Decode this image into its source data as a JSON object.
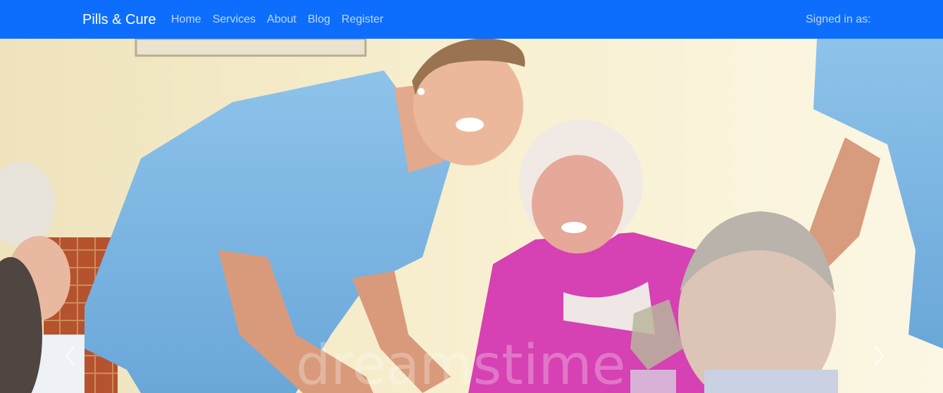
{
  "navbar": {
    "brand": "Pills & Cure",
    "links": [
      {
        "label": "Home"
      },
      {
        "label": "Services"
      },
      {
        "label": "About"
      },
      {
        "label": "Blog"
      },
      {
        "label": "Register"
      }
    ],
    "signed_in_label": "Signed in as:"
  },
  "carousel": {
    "image_watermark": "dreamstime",
    "prev_icon": "chevron-left-icon",
    "next_icon": "chevron-right-icon"
  },
  "colors": {
    "navbar_bg": "#0d6efd",
    "brand_text": "#ffffff",
    "link_text": "rgba(255,255,255,0.72)"
  }
}
